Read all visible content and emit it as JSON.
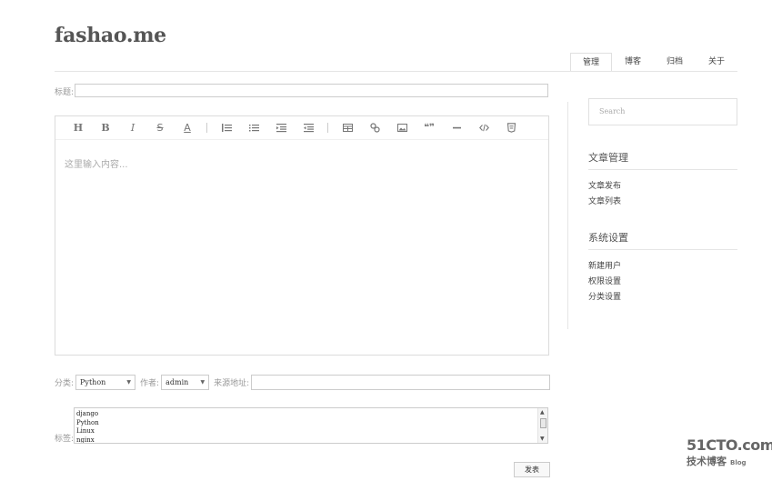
{
  "brand": "fashao.me",
  "nav": {
    "tabs": [
      {
        "label": "管理"
      },
      {
        "label": "博客"
      },
      {
        "label": "归档"
      },
      {
        "label": "关于"
      }
    ]
  },
  "form": {
    "title_label": "标题:",
    "toolbar": {
      "heading": "H",
      "bold": "B",
      "italic": "I",
      "strike": "S",
      "underline": "A",
      "quote": "❝❞"
    },
    "content_placeholder": "这里输入内容...",
    "category_label": "分类:",
    "category_value": "Python",
    "author_label": "作者:",
    "author_value": "admin",
    "source_label": "来源地址:",
    "tags_label": "标签:",
    "tags": [
      "django",
      "Python",
      "Linux",
      "nginx"
    ],
    "publish_label": "发表"
  },
  "sidebar": {
    "search_placeholder": "Search",
    "sections": [
      {
        "title": "文章管理",
        "links": [
          "文章发布",
          "文章列表"
        ]
      },
      {
        "title": "系统设置",
        "links": [
          "新建用户",
          "权限设置",
          "分类设置"
        ]
      }
    ]
  },
  "watermark": {
    "site": "51CTO.com",
    "cn": "技术博客",
    "blog": "Blog"
  }
}
